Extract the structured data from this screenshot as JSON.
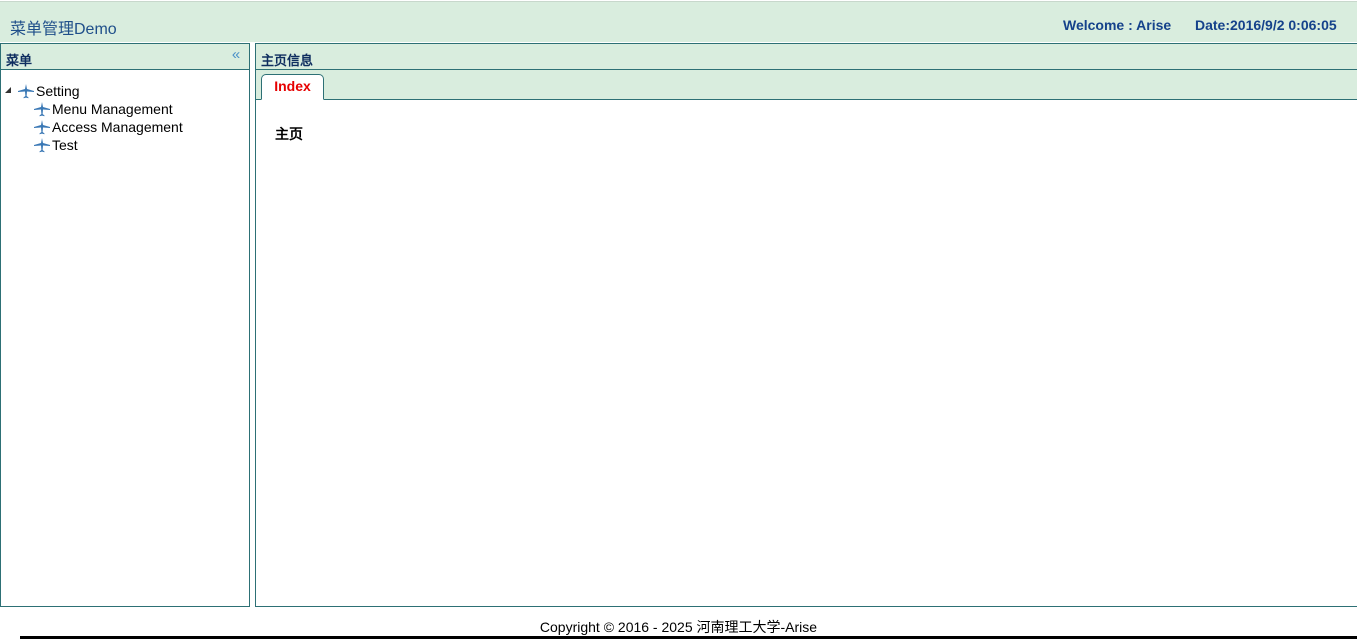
{
  "header": {
    "title": "菜单管理Demo",
    "welcome": "Welcome : Arise",
    "date": "Date:2016/9/2 0:06:05"
  },
  "sidebar": {
    "title": "菜单",
    "collapse_icon": "double-chevron-left-icon",
    "tree": {
      "root": {
        "label": "Setting",
        "expanded": true,
        "icon": "airplane-icon"
      },
      "children": [
        {
          "label": "Menu Management",
          "icon": "airplane-icon"
        },
        {
          "label": "Access Management",
          "icon": "airplane-icon"
        },
        {
          "label": "Test",
          "icon": "airplane-icon"
        }
      ]
    }
  },
  "main": {
    "title": "主页信息",
    "tabs": [
      {
        "label": "Index",
        "active": true
      }
    ],
    "content_text": "主页"
  },
  "footer": {
    "copyright": "Copyright © 2016 - 2025 河南理工大学-Arise"
  },
  "colors": {
    "header_bg": "#d9edde",
    "border": "#2d7075",
    "title_blue": "#15428b",
    "active_tab_text": "#e60000"
  }
}
